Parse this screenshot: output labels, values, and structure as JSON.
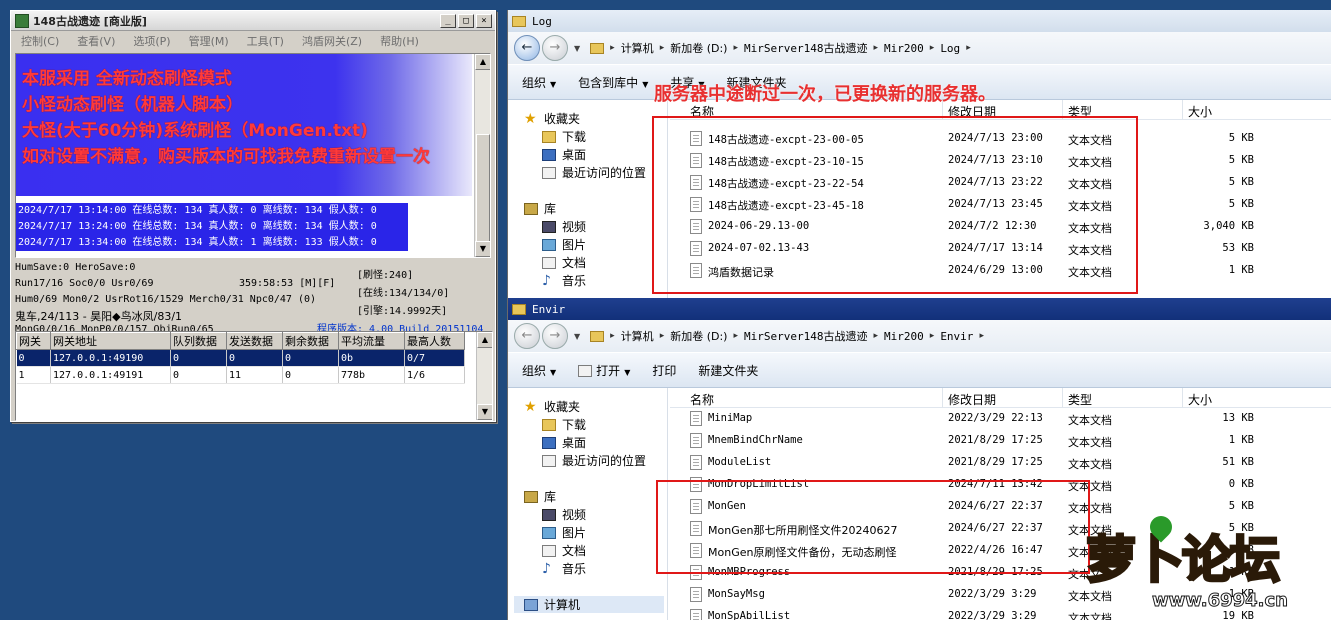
{
  "server": {
    "title": "148古战遗迹 [商业版]",
    "win_min": "_",
    "win_max": "□",
    "win_close": "×",
    "menu": [
      "控制(C)",
      "查看(V)",
      "选项(P)",
      "管理(M)",
      "工具(T)",
      "鸿盾网关(Z)",
      "帮助(H)"
    ],
    "banner": [
      "本服采用 全新动态刷怪模式",
      "小怪动态刷怪（机器人脚本）",
      "大怪(大于60分钟)系统刷怪（MonGen.txt)",
      "如对设置不满意，购买版本的可找我免费重新设置一次"
    ],
    "log_lines": [
      "2024/7/17 13:14:00 在线总数: 134 真人数: 0 离线数: 134 假人数: 0",
      "2024/7/17 13:24:00 在线总数: 134 真人数: 0 离线数: 134 假人数: 0",
      "2024/7/17 13:34:00 在线总数: 134 真人数: 1 离线数: 133 假人数: 0"
    ],
    "stats": {
      "humsave": "HumSave:0 HeroSave:0",
      "run": "Run17/16 Soc0/0 Usr0/69",
      "uptime": "359:58:53 [M][F]",
      "hum": "Hum0/69 Mon0/2 UsrRot16/1529 Merch0/31 Npc0/47 (0)",
      "map": "鬼车,24/113 - 昊阳◆鸟冰凤/83/1",
      "mongen": "MonG0/0/16 MonP0/0/157 ObjRun0/65",
      "refresh": "[刷怪:240]",
      "online": "[在线:134/134/0]",
      "engine": "[引擎:14.9992天]",
      "version": "程序版本: 4.00 Build 20151104"
    },
    "gateway": {
      "headers": [
        "网关",
        "网关地址",
        "队列数据",
        "发送数据",
        "剩余数据",
        "平均流量",
        "最高人数"
      ],
      "rows": [
        [
          "0",
          "127.0.0.1:49190",
          "0",
          "0",
          "0",
          "0b",
          "0/7"
        ],
        [
          "1",
          "127.0.0.1:49191",
          "0",
          "11",
          "0",
          "778b",
          "1/6"
        ]
      ]
    }
  },
  "log_window": {
    "title": "Log",
    "path": [
      "计算机",
      "新加卷 (D:)",
      "MirServer148古战遗迹",
      "Mir200",
      "Log"
    ],
    "toolbar": [
      "组织",
      "包含到库中",
      "共享",
      "新建文件夹"
    ],
    "columns": [
      "名称",
      "修改日期",
      "类型",
      "大小"
    ],
    "nav": [
      "收藏夹",
      "下载",
      "桌面",
      "最近访问的位置",
      "库",
      "视频",
      "图片",
      "文档",
      "音乐"
    ],
    "files": [
      {
        "name": "148古战遗迹-excpt-23-00-05",
        "date": "2024/7/13 23:00",
        "type": "文本文档",
        "size": "5 KB"
      },
      {
        "name": "148古战遗迹-excpt-23-10-15",
        "date": "2024/7/13 23:10",
        "type": "文本文档",
        "size": "5 KB"
      },
      {
        "name": "148古战遗迹-excpt-23-22-54",
        "date": "2024/7/13 23:22",
        "type": "文本文档",
        "size": "5 KB"
      },
      {
        "name": "148古战遗迹-excpt-23-45-18",
        "date": "2024/7/13 23:45",
        "type": "文本文档",
        "size": "5 KB"
      },
      {
        "name": "2024-06-29.13-00",
        "date": "2024/7/2 12:30",
        "type": "文本文档",
        "size": "3,040 KB"
      },
      {
        "name": "2024-07-02.13-43",
        "date": "2024/7/17 13:14",
        "type": "文本文档",
        "size": "53 KB"
      },
      {
        "name": "鸿盾数据记录",
        "date": "2024/6/29 13:00",
        "type": "文本文档",
        "size": "1 KB"
      }
    ]
  },
  "envir_window": {
    "title": "Envir",
    "path": [
      "计算机",
      "新加卷 (D:)",
      "MirServer148古战遗迹",
      "Mir200",
      "Envir"
    ],
    "toolbar": [
      "组织",
      "打开",
      "打印",
      "新建文件夹"
    ],
    "columns": [
      "名称",
      "修改日期",
      "类型",
      "大小"
    ],
    "nav": [
      "收藏夹",
      "下载",
      "桌面",
      "最近访问的位置",
      "库",
      "视频",
      "图片",
      "文档",
      "音乐",
      "计算机"
    ],
    "files": [
      {
        "name": "MiniMap",
        "date": "2022/3/29 22:13",
        "type": "文本文档",
        "size": "13 KB"
      },
      {
        "name": "MnemBindChrName",
        "date": "2021/8/29 17:25",
        "type": "文本文档",
        "size": "1 KB"
      },
      {
        "name": "ModuleList",
        "date": "2021/8/29 17:25",
        "type": "文本文档",
        "size": "51 KB"
      },
      {
        "name": "MonDropLimitList",
        "date": "2024/7/11 13:42",
        "type": "文本文档",
        "size": "0 KB"
      },
      {
        "name": "MonGen",
        "date": "2024/6/27 22:37",
        "type": "文本文档",
        "size": "5 KB"
      },
      {
        "name": "MonGen那七所用刷怪文件20240627",
        "date": "2024/6/27 22:37",
        "type": "文本文档",
        "size": "5 KB"
      },
      {
        "name": "MonGen原刷怪文件备份，无动态刷怪",
        "date": "2022/4/26 16:47",
        "type": "文本文档",
        "size": "5 KB"
      },
      {
        "name": "MonMBProgress",
        "date": "2021/8/29 17:25",
        "type": "文本文档",
        "size": "1 KB"
      },
      {
        "name": "MonSayMsg",
        "date": "2022/3/29 3:29",
        "type": "文本文档",
        "size": "1 KB"
      },
      {
        "name": "MonSpAbilList",
        "date": "2022/3/29 3:29",
        "type": "文本文档",
        "size": "19 KB"
      }
    ]
  },
  "annotation": "服务器中途断过一次，已更换新的服务器。",
  "watermark": {
    "brand": "萝卜论坛",
    "url": "www.6994.cn"
  }
}
